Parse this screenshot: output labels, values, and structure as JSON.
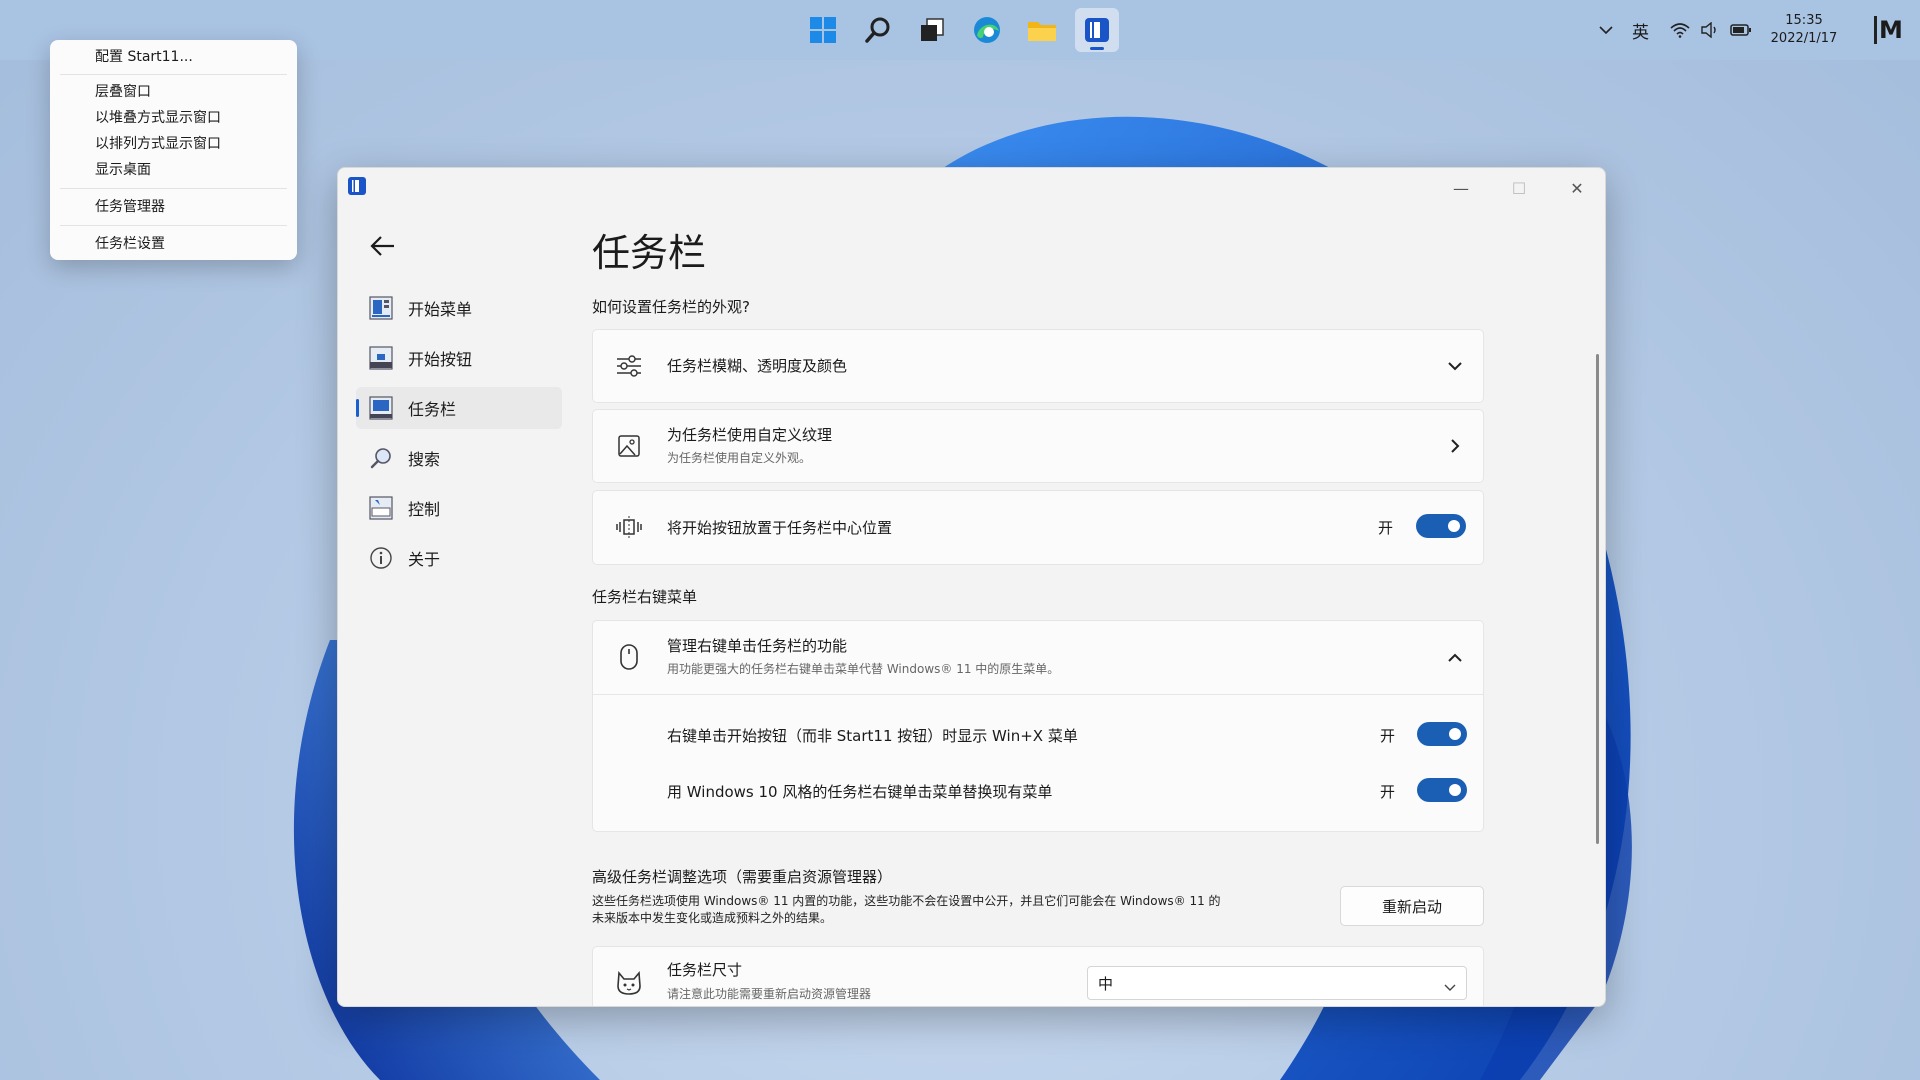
{
  "taskbar": {
    "tray": {
      "ime": "英",
      "time": "15:35",
      "date": "2022/1/17",
      "brand": "M"
    }
  },
  "context_menu": {
    "items": [
      "配置 Start11...",
      "层叠窗口",
      "以堆叠方式显示窗口",
      "以排列方式显示窗口",
      "显示桌面",
      "任务管理器",
      "任务栏设置"
    ]
  },
  "window": {
    "controls": {
      "minimize": "—",
      "maximize": "☐",
      "close": "✕"
    },
    "nav": {
      "items": [
        {
          "label": "开始菜单",
          "icon": "start-menu-icon"
        },
        {
          "label": "开始按钮",
          "icon": "start-button-icon"
        },
        {
          "label": "任务栏",
          "icon": "taskbar-icon",
          "selected": true
        },
        {
          "label": "搜索",
          "icon": "search-icon"
        },
        {
          "label": "控制",
          "icon": "control-icon"
        },
        {
          "label": "关于",
          "icon": "info-icon"
        }
      ]
    },
    "page_title": "任务栏",
    "section1": {
      "heading": "如何设置任务栏的外观?",
      "blur_card": {
        "title": "任务栏模糊、透明度及颜色"
      },
      "texture_card": {
        "title": "为任务栏使用自定义纹理",
        "subtitle": "为任务栏使用自定义外观。"
      },
      "center_card": {
        "title": "将开始按钮放置于任务栏中心位置",
        "state": "开"
      }
    },
    "section2": {
      "heading": "任务栏右键菜单",
      "manage_card": {
        "title": "管理右键单击任务栏的功能",
        "subtitle": "用功能更强大的任务栏右键单击菜单代替 Windows® 11 中的原生菜单。",
        "options": [
          {
            "label": "右键单击开始按钮（而非 Start11 按钮）时显示 Win+X 菜单",
            "state": "开"
          },
          {
            "label": "用 Windows 10 风格的任务栏右键单击菜单替换现有菜单",
            "state": "开"
          }
        ]
      }
    },
    "section3": {
      "heading": "高级任务栏调整选项（需要重启资源管理器）",
      "desc_line1": "这些任务栏选项使用 Windows® 11 内置的功能，这些功能不会在设置中公开，并且它们可能会在 Windows® 11 的",
      "desc_line2": "未来版本中发生变化或造成预料之外的结果。",
      "restart_button": "重新启动",
      "size_card": {
        "title": "任务栏尺寸",
        "subtitle": "请注意此功能需要重新启动资源管理器",
        "value": "中"
      }
    }
  },
  "colors": {
    "accent": "#1a5fb4",
    "window_bg": "#f3f3f3",
    "card_bg": "#fbfbfb"
  }
}
